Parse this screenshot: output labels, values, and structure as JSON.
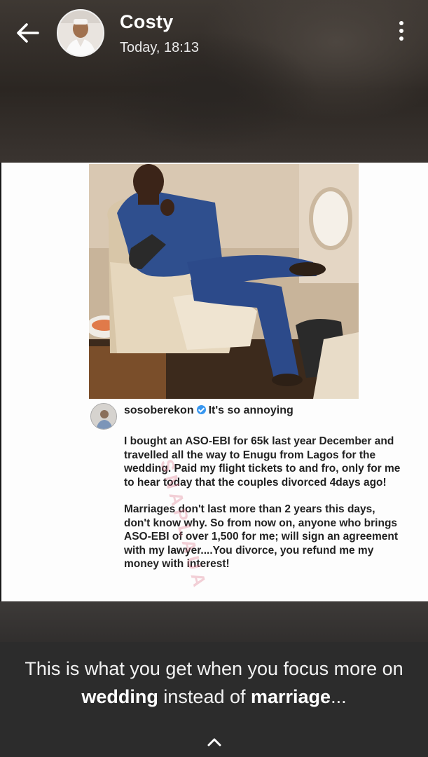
{
  "header": {
    "contact_name": "Costy",
    "timestamp": "Today, 18:13",
    "back_icon": "arrow-left-icon",
    "menu_icon": "more-vertical-icon"
  },
  "post": {
    "username": "sosoberekon",
    "verified": true,
    "title": "It's so annoying",
    "paragraph_1": "I bought an ASO-EBI for 65k last year December and travelled all the way to Enugu from Lagos for the wedding. Paid my flight tickets to and fro, only for me to hear today that the couples divorced 4days ago!",
    "paragraph_2": "Marriages don't last more than 2 years this days, don't know why. So from now on, anyone who brings ASO-EBI of over 1,500 for me; will sign an agreement with my lawyer....You divorce, you refund me my money with interest!"
  },
  "status_caption": {
    "part_1": "This is what you get when you focus more on ",
    "bold_1": "wedding",
    "part_2": " instead of ",
    "bold_2": "marriage",
    "part_3": "..."
  },
  "colors": {
    "verified_badge": "#3897f0",
    "caption_bar": "#2c2c2c"
  }
}
